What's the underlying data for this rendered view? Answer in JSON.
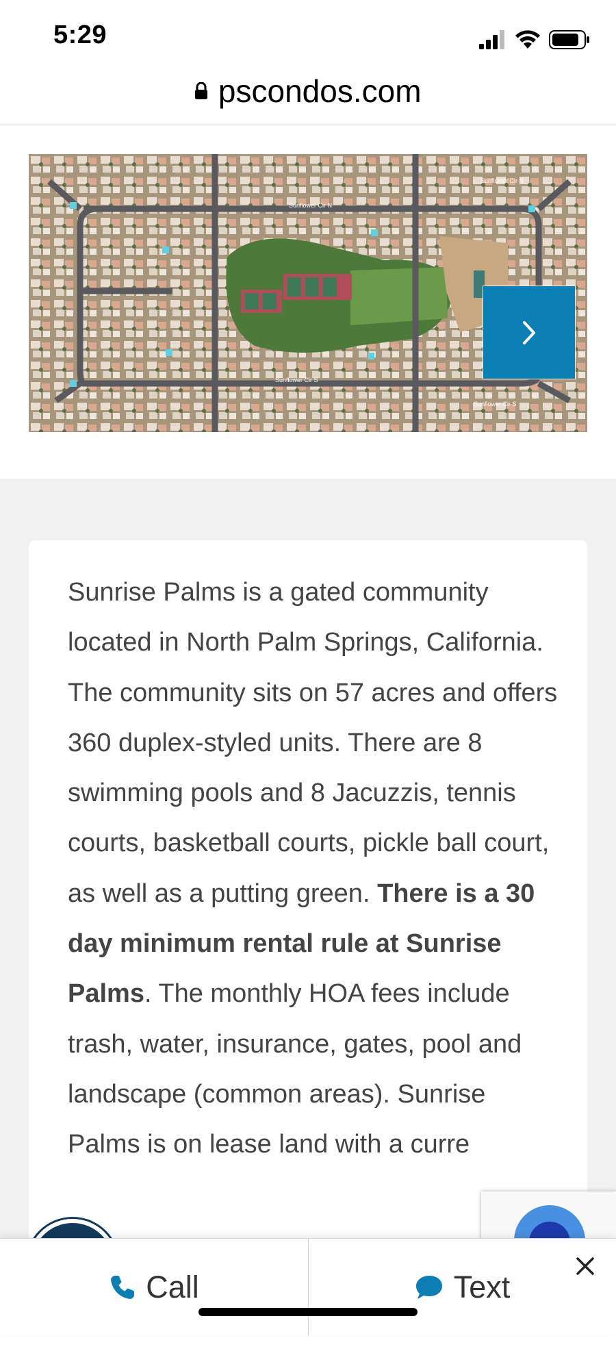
{
  "status": {
    "time": "5:29"
  },
  "browser": {
    "url": "pscondos.com"
  },
  "gallery": {
    "image_alt": "Aerial view of Sunrise Palms community",
    "street_labels": [
      "Sunflower Cir N",
      "Sunflower Cir N",
      "Sunflower Cir S",
      "Sunflower Cir S"
    ]
  },
  "description": {
    "part1": "Sunrise Palms is a gated community located in North Palm Springs, California. The community sits on 57 acres and offers 360 duplex-styled units. There are 8 swimming pools and 8 Jacuzzis, tennis courts, basketball courts, pickle ball court, as well as a putting green. ",
    "bold": "There is a 30 day minimum rental rule at Sunrise Palms",
    "part2": ". The monthly HOA fees include trash, water, insurance, gates, pool and landscape (common areas). Sunrise Palms is on lease land with a curre"
  },
  "bottom_bar": {
    "call_label": "Call",
    "text_label": "Text"
  },
  "colors": {
    "accent_blue": "#0b7fb3",
    "gray_bg": "#f1f1f1",
    "text": "#444444"
  },
  "icons": {
    "signal": "cellular-signal-icon",
    "wifi": "wifi-icon",
    "battery": "battery-icon",
    "lock": "lock-icon",
    "next": "chevron-right-icon",
    "phone": "phone-icon",
    "chat": "chat-bubble-icon",
    "close": "close-icon"
  }
}
